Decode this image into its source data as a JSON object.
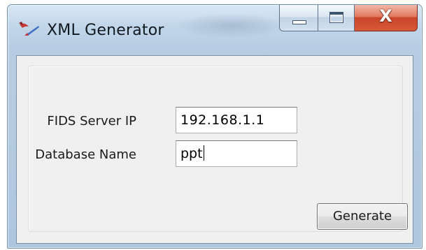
{
  "window": {
    "title": "XML Generator",
    "icon": "quill-pen-icon",
    "caption_buttons": {
      "minimize": "minimize-icon",
      "maximize": "maximize-icon",
      "close_glyph": "X"
    }
  },
  "form": {
    "server_ip_label": "FIDS Server IP",
    "server_ip_value": "192.168.1.1",
    "database_name_label": "Database Name",
    "database_name_value": "ppt",
    "generate_label": "Generate"
  },
  "colors": {
    "client_background": "#f0f0f0",
    "close_button": "#c9462a",
    "window_frame": "#b7cde3"
  }
}
